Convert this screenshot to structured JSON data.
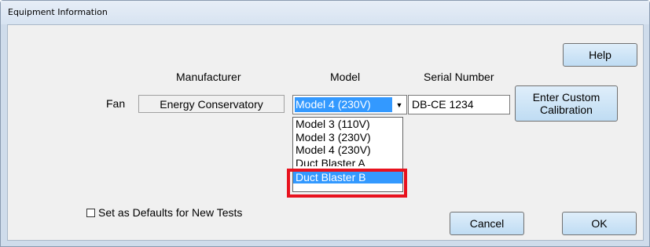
{
  "window": {
    "title": "Equipment Information"
  },
  "headers": {
    "manufacturer": "Manufacturer",
    "model": "Model",
    "serial_number": "Serial Number"
  },
  "fan": {
    "label": "Fan",
    "manufacturer": "Energy Conservatory",
    "model_selected": "Model 4 (230V)",
    "serial_number": "DB-CE 1234"
  },
  "model_dropdown": {
    "open": true,
    "options": [
      "Model 3 (110V)",
      "Model 3 (230V)",
      "Model 4 (230V)",
      "Duct Blaster A",
      "Duct Blaster B"
    ],
    "highlighted": "Duct Blaster B",
    "annotation_color": "#e8121e"
  },
  "buttons": {
    "help": "Help",
    "custom_calibration": "Enter Custom Calibration",
    "cancel": "Cancel",
    "ok": "OK"
  },
  "defaults_checkbox": {
    "label": "Set as Defaults for New Tests",
    "checked": false
  },
  "colors": {
    "selection": "#3399ff",
    "button_top": "#dfeefa",
    "button_bottom": "#bfdcf3"
  }
}
